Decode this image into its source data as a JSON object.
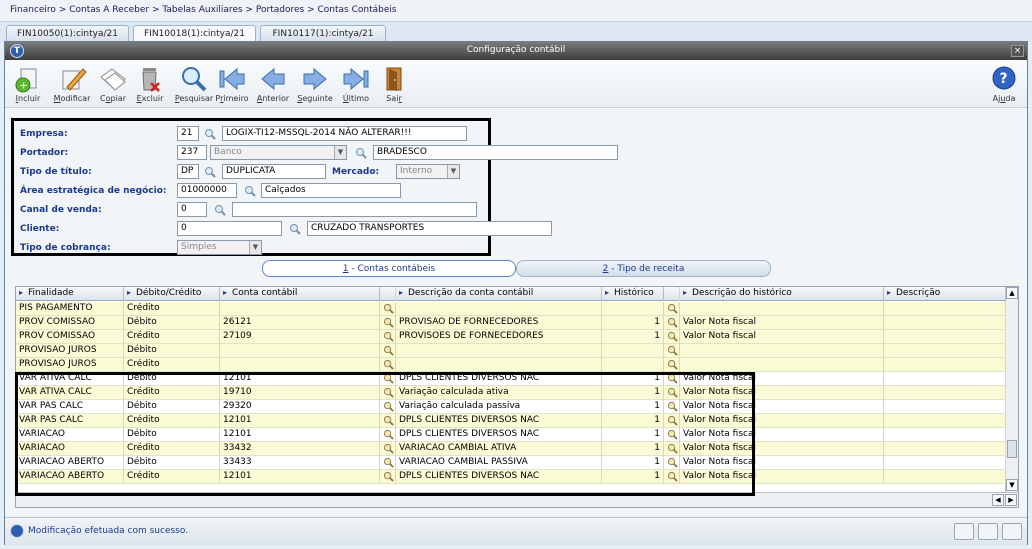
{
  "breadcrumb": "Financeiro > Contas A Receber > Tabelas Auxiliares > Portadores > Contas Contábeis",
  "window_tabs": [
    {
      "label": "FIN10050(1):cintya/21"
    },
    {
      "label": "FIN10018(1):cintya/21"
    },
    {
      "label": "FIN10117(1):cintya/21"
    }
  ],
  "window": {
    "title": "Configuração contábil",
    "close": "×"
  },
  "toolbar": {
    "incluir": {
      "pre": "",
      "u": "I",
      "post": "ncluir"
    },
    "modificar": {
      "pre": "",
      "u": "M",
      "post": "odificar"
    },
    "copiar": {
      "pre": "C",
      "u": "o",
      "post": "piar"
    },
    "excluir": {
      "pre": "",
      "u": "E",
      "post": "xcluir"
    },
    "pesquisar": {
      "pre": "",
      "u": "P",
      "post": "esquisar"
    },
    "primeiro": {
      "pre": "P",
      "u": "r",
      "post": "imeiro"
    },
    "anterior": {
      "pre": "",
      "u": "A",
      "post": "nterior"
    },
    "seguinte": {
      "pre": "",
      "u": "S",
      "post": "eguinte"
    },
    "ultimo": {
      "pre": "",
      "u": "Ú",
      "post": "ltimo"
    },
    "sair": {
      "pre": "Sai",
      "u": "r",
      "post": ""
    },
    "ajuda": {
      "pre": "Aj",
      "u": "u",
      "post": "da"
    }
  },
  "form": {
    "empresa": {
      "label": "Empresa:",
      "code": "21",
      "desc": "LOGIX-TI12-MSSQL-2014 NÃO ALTERAR!!!"
    },
    "portador": {
      "label": "Portador:",
      "code": "237",
      "type": "Banco",
      "desc": "BRADESCO"
    },
    "tipo_titulo": {
      "label": "Tipo de título:",
      "code": "DP",
      "desc": "DUPLICATA"
    },
    "mercado": {
      "label": "Mercado:",
      "value": "Interno"
    },
    "area": {
      "label": "Área estratégica de negócio:",
      "code": "01000000",
      "desc": "Calçados"
    },
    "canal": {
      "label": "Canal de venda:",
      "code": "0",
      "desc": ""
    },
    "cliente": {
      "label": "Cliente:",
      "code": "0",
      "desc": "CRUZADO TRANSPORTES"
    },
    "cobranca": {
      "label": "Tipo de cobrança:",
      "value": "Simples"
    }
  },
  "subtabs": [
    {
      "num": "1",
      "label": " - Contas contábeis"
    },
    {
      "num": "2",
      "label": " - Tipo de receita"
    }
  ],
  "grid": {
    "headers": [
      "Finalidade",
      "Débito/Crédito",
      "Conta contábil",
      "Descrição da conta contábil",
      "Histórico",
      "Descrição do histórico",
      "Descrição"
    ],
    "rows": [
      [
        "PIS PAGAMENTO",
        "Crédito",
        "",
        "",
        "",
        "",
        ""
      ],
      [
        "PROV COMISSAO",
        "Débito",
        "26121",
        "PROVISAO DE FORNECEDORES",
        "1",
        "Valor Nota fiscal",
        ""
      ],
      [
        "PROV COMISSAO",
        "Crédito",
        "27109",
        "PROVISOES DE FORNECEDORES",
        "1",
        "Valor Nota fiscal",
        ""
      ],
      [
        "PROVISAO JUROS",
        "Débito",
        "",
        "",
        "",
        "",
        ""
      ],
      [
        "PROVISAO JUROS",
        "Crédito",
        "",
        "",
        "",
        "",
        ""
      ],
      [
        "VAR ATIVA CALC",
        "Débito",
        "12101",
        "DPLS CLIENTES DIVERSOS NAC",
        "1",
        "Valor Nota fiscal",
        ""
      ],
      [
        "VAR ATIVA CALC",
        "Crédito",
        "19710",
        "Variação calculada ativa",
        "1",
        "Valor Nota fiscal",
        ""
      ],
      [
        "VAR PAS CALC",
        "Débito",
        "29320",
        "Variação calculada passiva",
        "1",
        "Valor Nota fiscal",
        ""
      ],
      [
        "VAR PAS CALC",
        "Crédito",
        "12101",
        "DPLS CLIENTES DIVERSOS NAC",
        "1",
        "Valor Nota fiscal",
        ""
      ],
      [
        "VARIACAO",
        "Débito",
        "12101",
        "DPLS CLIENTES DIVERSOS NAC",
        "1",
        "Valor Nota fiscal",
        ""
      ],
      [
        "VARIACAO",
        "Crédito",
        "33432",
        "VARIACAO CAMBIAL ATIVA",
        "1",
        "Valor Nota fiscal",
        ""
      ],
      [
        "VARIACAO ABERTO",
        "Débito",
        "33433",
        "VARIACAO CAMBIAL PASSIVA",
        "1",
        "Valor Nota fiscal",
        ""
      ],
      [
        "VARIACAO ABERTO",
        "Crédito",
        "12101",
        "DPLS CLIENTES DIVERSOS NAC",
        "1",
        "Valor Nota fiscal",
        ""
      ]
    ]
  },
  "status": {
    "message": "Modificação efetuada com sucesso."
  },
  "icons": {
    "toolbar": [
      "add-document-icon",
      "edit-pencil-icon",
      "copy-icon",
      "trash-icon",
      "magnifier-icon",
      "first-arrow-icon",
      "previous-arrow-icon",
      "next-arrow-icon",
      "last-arrow-icon",
      "exit-door-icon",
      "help-icon"
    ],
    "lookup": "magnifier-icon"
  },
  "colors": {
    "title_bar": "#4a4a4a",
    "label_text": "#1b3a8a",
    "row_yellow": "#fafad4",
    "row_white": "#ffffff",
    "highlight_border": "#000000"
  }
}
